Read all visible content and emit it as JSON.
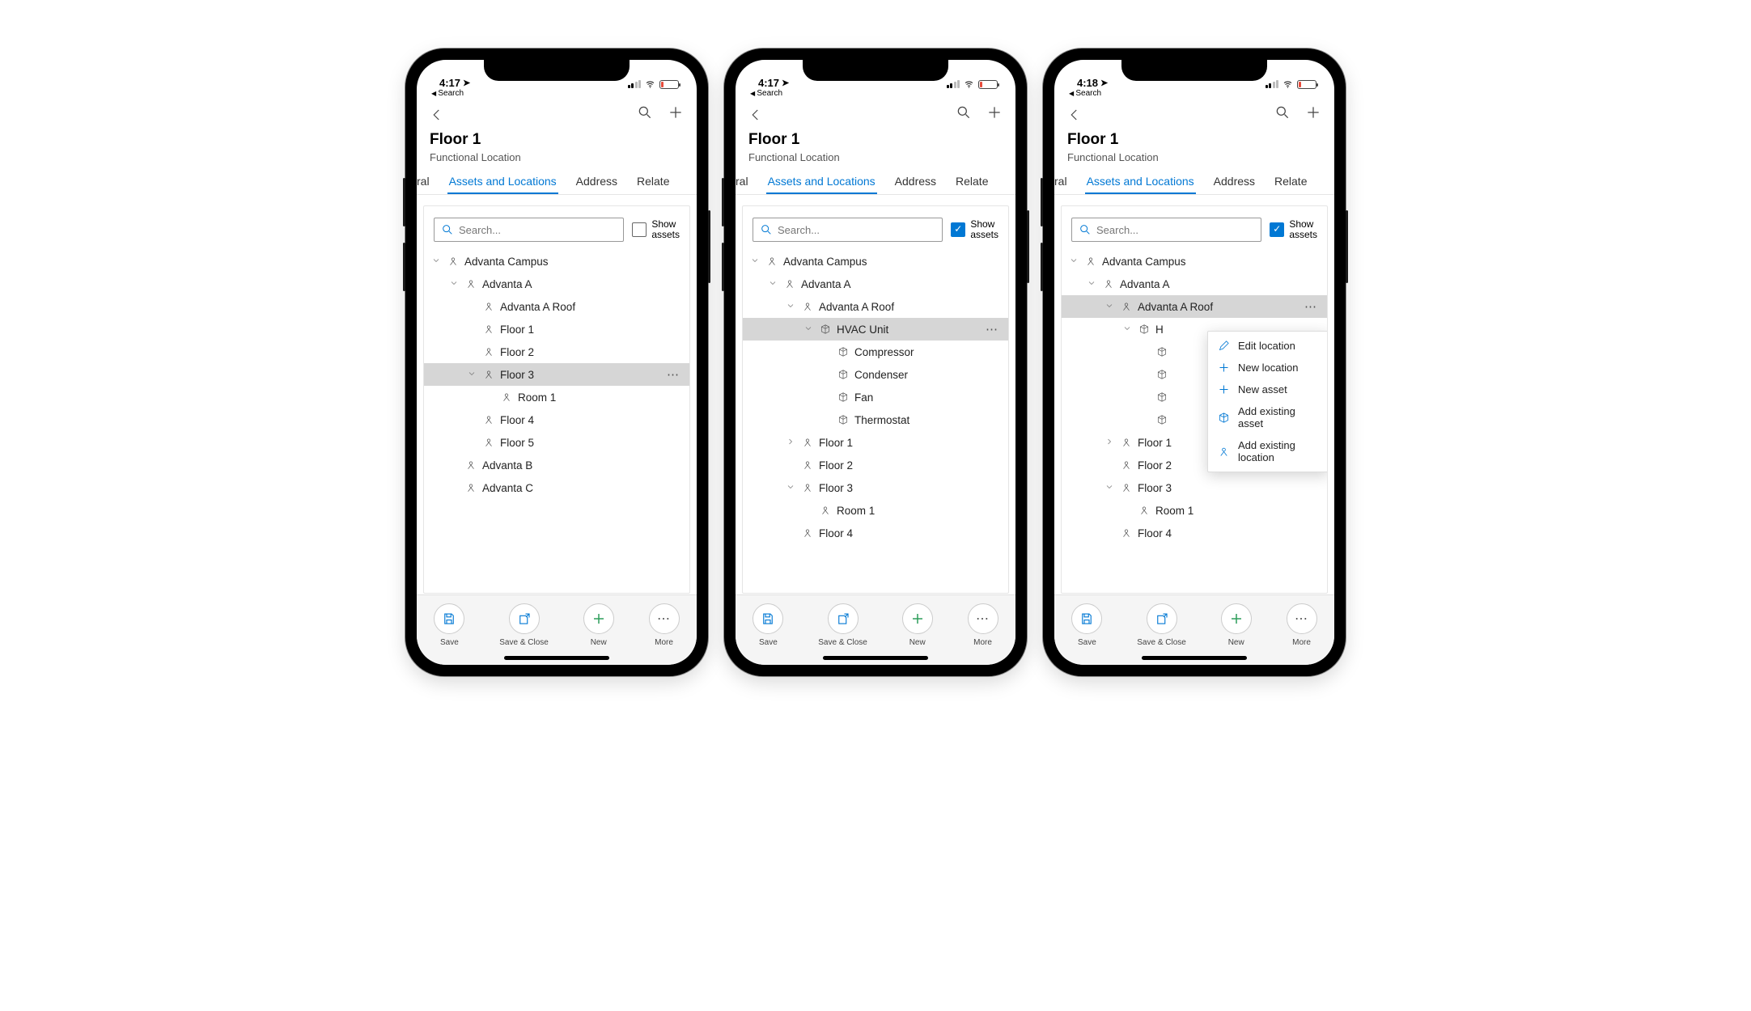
{
  "status": {
    "back_label": "Search"
  },
  "page": {
    "title": "Floor 1",
    "subtitle": "Functional Location"
  },
  "tabs": {
    "general_cut": "ral",
    "assets": "Assets and Locations",
    "address": "Address",
    "related_cut": "Relate"
  },
  "search": {
    "placeholder": "Search..."
  },
  "show_assets": {
    "line1": "Show",
    "line2": "assets"
  },
  "screen1": {
    "time": "4:17",
    "show_checked": false,
    "tree": {
      "n0": "Advanta Campus",
      "n1": "Advanta A",
      "n2": "Advanta A Roof",
      "n3": "Floor 1",
      "n4": "Floor 2",
      "n5": "Floor 3",
      "n6": "Room 1",
      "n7": "Floor 4",
      "n8": "Floor 5",
      "n9": "Advanta B",
      "n10": "Advanta C"
    }
  },
  "screen2": {
    "time": "4:17",
    "show_checked": true,
    "tree": {
      "n0": "Advanta Campus",
      "n1": "Advanta A",
      "n2": "Advanta A Roof",
      "n3": "HVAC Unit",
      "n4": "Compressor",
      "n5": "Condenser",
      "n6": "Fan",
      "n7": "Thermostat",
      "n8": "Floor 1",
      "n9": "Floor 2",
      "n10": "Floor 3",
      "n11": "Room 1",
      "n12": "Floor 4"
    }
  },
  "screen3": {
    "time": "4:18",
    "show_checked": true,
    "tree": {
      "n0": "Advanta Campus",
      "n1": "Advanta A",
      "n2": "Advanta A Roof",
      "n3": "H",
      "n8": "Floor 1",
      "n9": "Floor 2",
      "n10": "Floor 3",
      "n11": "Room 1",
      "n12": "Floor 4"
    },
    "menu": {
      "edit": "Edit location",
      "newloc": "New location",
      "newasset": "New asset",
      "addasset": "Add existing asset",
      "addloc": "Add existing location"
    }
  },
  "bottom": {
    "save": "Save",
    "saveclose": "Save & Close",
    "new": "New",
    "more": "More"
  }
}
